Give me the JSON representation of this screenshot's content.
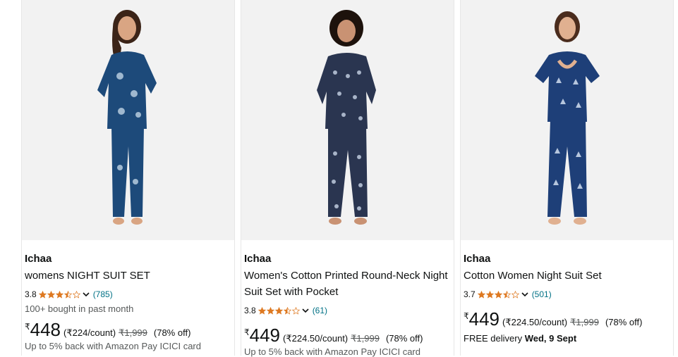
{
  "products": [
    {
      "brand": "Ichaa",
      "title": "womens NIGHT SUIT SET",
      "rating": "3.8",
      "stars": [
        1,
        1,
        1,
        0.5,
        0
      ],
      "review_count": "(785)",
      "bought": "100+ bought in past month",
      "currency": "₹",
      "price": "448",
      "unit_price": "(₹224/count)",
      "mrp": "₹1,999",
      "discount": "(78% off)",
      "extra": "Up to 5% back with Amazon Pay ICICI card",
      "delivery_label": "",
      "delivery_date": ""
    },
    {
      "brand": "Ichaa",
      "title": "Women's Cotton Printed Round-Neck Night Suit Set with Pocket",
      "rating": "3.8",
      "stars": [
        1,
        1,
        1,
        0.5,
        0
      ],
      "review_count": "(61)",
      "bought": "",
      "currency": "₹",
      "price": "449",
      "unit_price": "(₹224.50/count)",
      "mrp": "₹1,999",
      "discount": "(78% off)",
      "extra": "Up to 5% back with Amazon Pay ICICI card",
      "delivery_label": "",
      "delivery_date": ""
    },
    {
      "brand": "Ichaa",
      "title": "Cotton Women Night Suit Set",
      "rating": "3.7",
      "stars": [
        1,
        1,
        1,
        0.5,
        0
      ],
      "review_count": "(501)",
      "bought": "",
      "currency": "₹",
      "price": "449",
      "unit_price": "(₹224.50/count)",
      "mrp": "₹1,999",
      "discount": "(78% off)",
      "extra": "",
      "delivery_label": "FREE delivery",
      "delivery_date": "Wed, 9 Sept"
    }
  ],
  "colors": {
    "star": "#de7921",
    "link": "#007185",
    "image_bg": "#f2f2f2",
    "suit_navy": "#1d4a7a",
    "suit_dark": "#2a3550"
  },
  "icons": [
    "star-icon",
    "chevron-down-icon"
  ]
}
